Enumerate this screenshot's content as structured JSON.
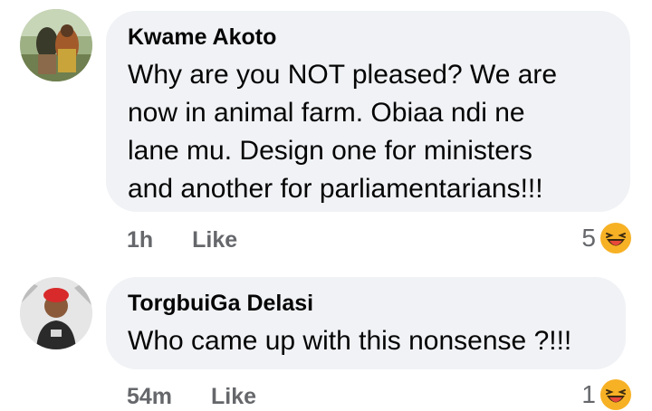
{
  "comments": [
    {
      "author": "Kwame Akoto",
      "text": "Why are you NOT pleased? We are\nnow in animal farm. Obiaa ndi ne\nlane mu. Design one for ministers\nand another for parliamentarians!!!",
      "time": "1h",
      "like_label": "Like",
      "reaction_count": "5",
      "reaction_icon": "laughing-emoji-icon"
    },
    {
      "author": "TorgbuiGa Delasi",
      "text": "Who came up with this nonsense ?!!!",
      "time": "54m",
      "like_label": "Like",
      "reaction_count": "1",
      "reaction_icon": "laughing-emoji-icon"
    }
  ],
  "colors": {
    "bubble": "#f0f2f5",
    "meta": "#65676b",
    "text": "#050505",
    "emoji": "#f7b125"
  }
}
